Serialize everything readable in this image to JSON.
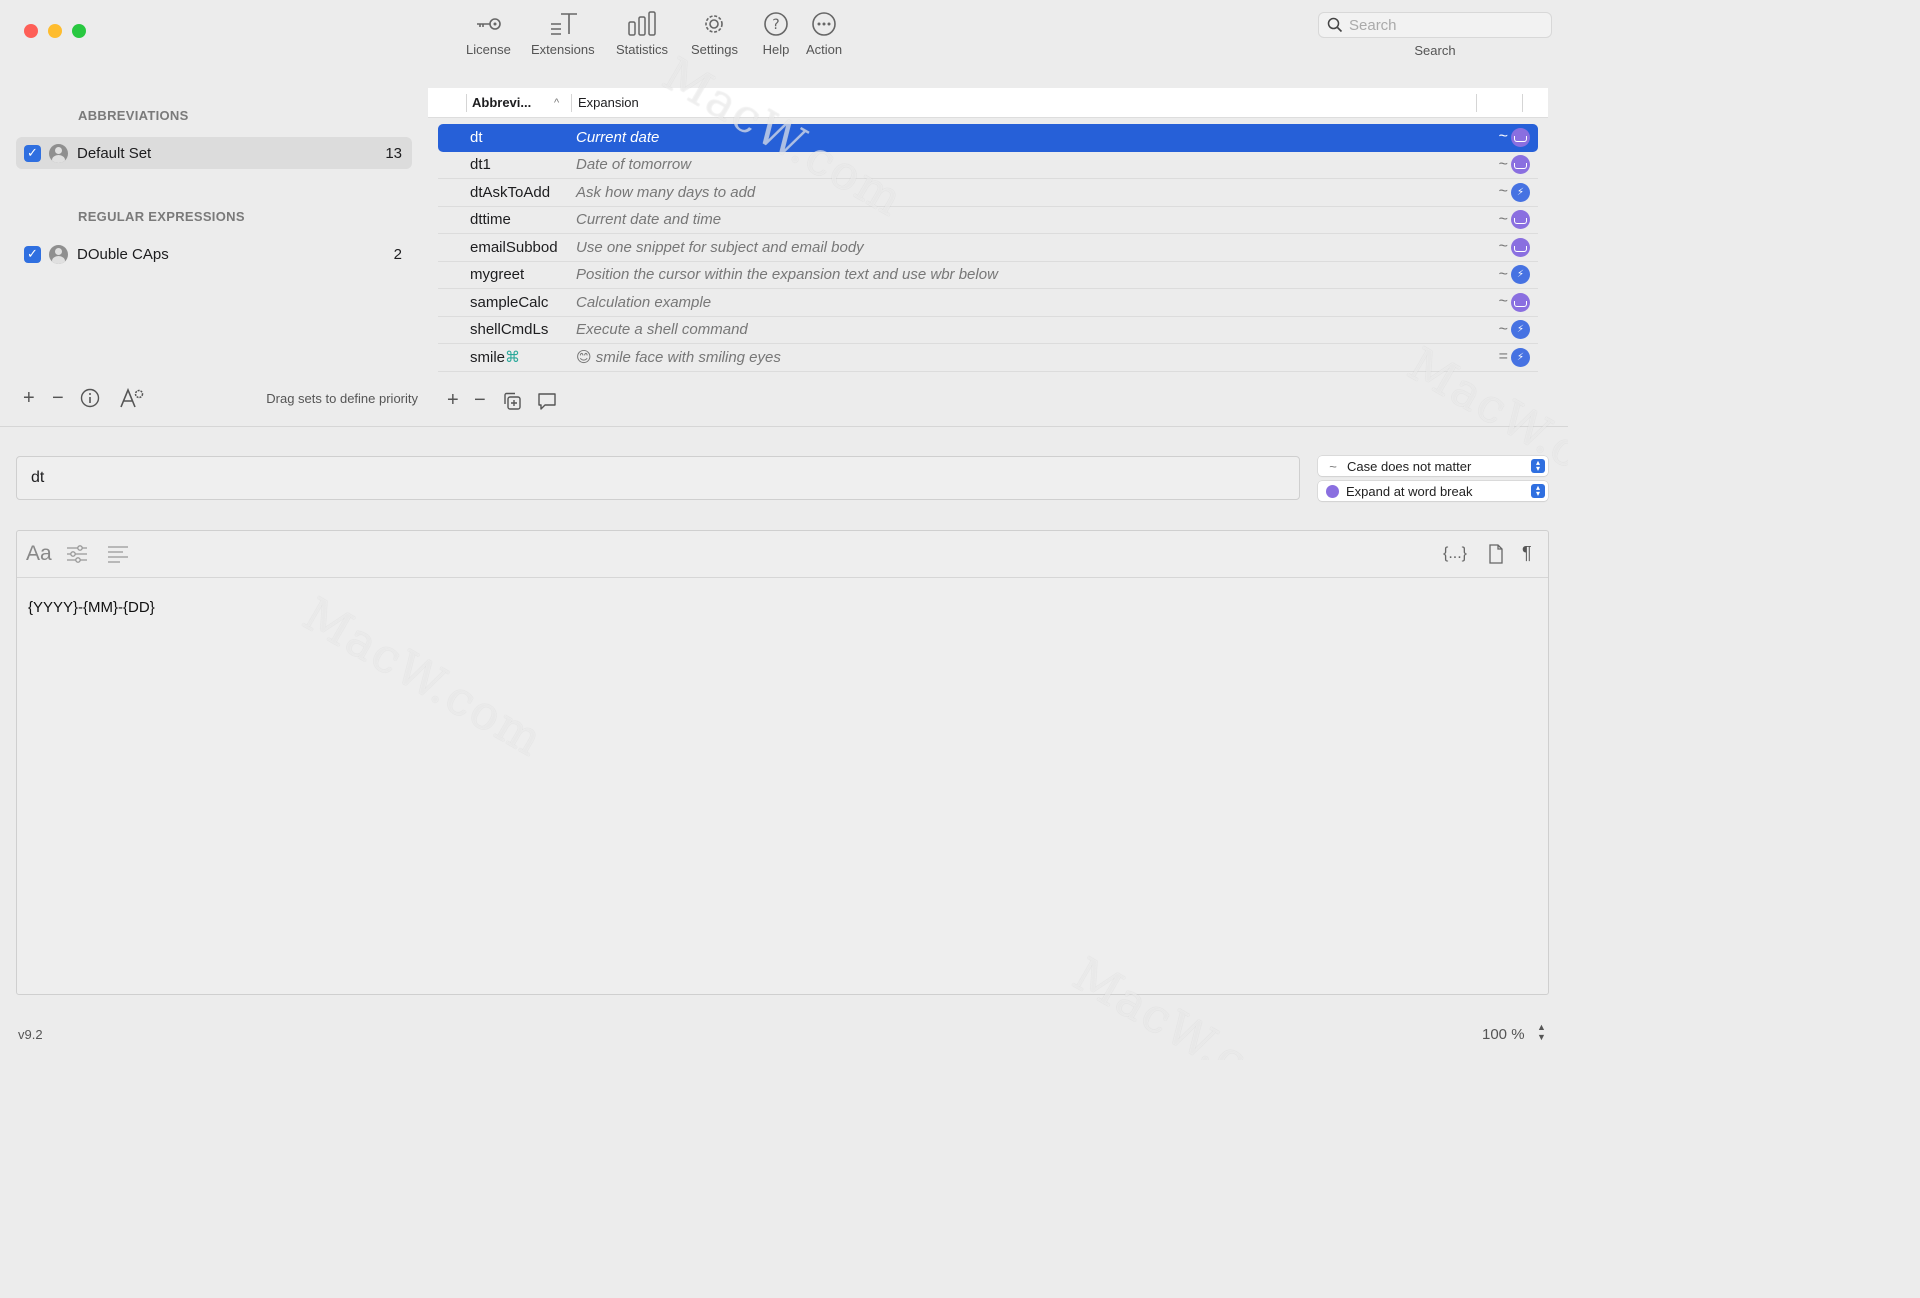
{
  "toolbar": {
    "items": [
      {
        "label": "License",
        "icon": "key-icon"
      },
      {
        "label": "Extensions",
        "icon": "text-extensions-icon"
      },
      {
        "label": "Statistics",
        "icon": "bar-chart-icon"
      },
      {
        "label": "Settings",
        "icon": "gear-icon"
      },
      {
        "label": "Help",
        "icon": "question-icon"
      },
      {
        "label": "Action",
        "icon": "ellipsis-icon"
      }
    ],
    "search_placeholder": "Search",
    "search_label": "Search"
  },
  "sidebar": {
    "abbreviations_title": "ABBREVIATIONS",
    "regex_title": "REGULAR EXPRESSIONS",
    "sets": [
      {
        "name": "Default Set",
        "count": "13",
        "checked": true,
        "selected": true
      },
      {
        "name": "DOuble CAps",
        "count": "2",
        "checked": true,
        "selected": false
      }
    ],
    "drag_hint": "Drag sets to define priority"
  },
  "table": {
    "col_abbreviation": "Abbrevi...",
    "col_expansion": "Expansion",
    "rows": [
      {
        "abbr": "dt",
        "exp": "Current date",
        "case": "~",
        "trigger": "word"
      },
      {
        "abbr": "dt1",
        "exp": "Date of tomorrow",
        "case": "~",
        "trigger": "word"
      },
      {
        "abbr": "dtAskToAdd",
        "exp": "Ask how many days to add",
        "case": "~",
        "trigger": "instant"
      },
      {
        "abbr": "dttime",
        "exp": "Current date and time",
        "case": "~",
        "trigger": "word"
      },
      {
        "abbr": "emailSubbod",
        "exp": "Use one snippet for subject and email body",
        "case": "~",
        "trigger": "word"
      },
      {
        "abbr": "mygreet",
        "exp": "Position the cursor within the expansion text and use wbr below",
        "case": "~",
        "trigger": "instant"
      },
      {
        "abbr": "sampleCalc",
        "exp": "Calculation example",
        "case": "~",
        "trigger": "word"
      },
      {
        "abbr": "shellCmdLs",
        "exp": "Execute a shell command",
        "case": "~",
        "trigger": "instant"
      },
      {
        "abbr": "smile",
        "abbr_suffix": "⌘",
        "exp": "😊 smile face with smiling eyes",
        "case": "=",
        "trigger": "instant"
      }
    ]
  },
  "detail": {
    "abbreviation_value": "dt",
    "case_option": "Case does not matter",
    "trigger_option": "Expand at word break",
    "editor_content": "{YYYY}-{MM}-{DD}",
    "editor_font_label": "Aa",
    "editor_placeholder_btn": "{...}",
    "paragraph_mark": "¶"
  },
  "status": {
    "version": "v9.2",
    "zoom": "100 %"
  },
  "watermark": "MacW.com",
  "colors": {
    "selection": "#2660d8",
    "word_trigger": "#8a6fe0",
    "instant_trigger": "#4672e2"
  }
}
